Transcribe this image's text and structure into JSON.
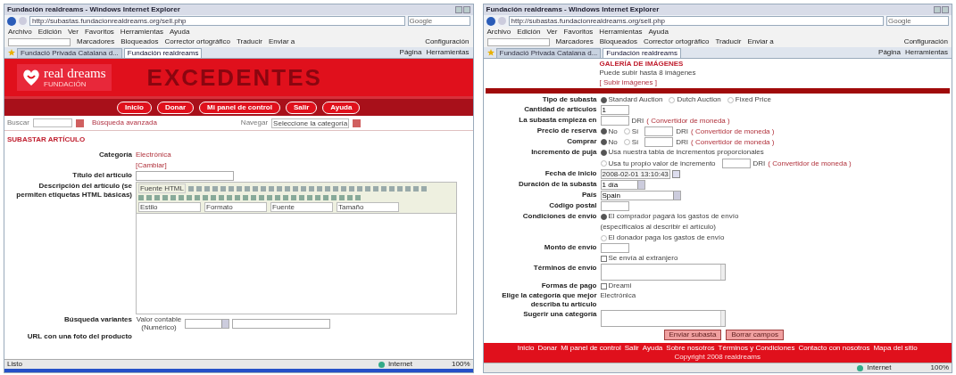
{
  "windows": [
    {
      "title": "Fundación realdreams - Windows Internet Explorer",
      "url": "http://subastas.fundacionrealdreams.org/sell.php",
      "search_placeholder": "Google",
      "menu": [
        "Archivo",
        "Edición",
        "Ver",
        "Favoritos",
        "Herramientas",
        "Ayuda"
      ],
      "google_toolbar": [
        "Marcadores",
        "Bloqueados",
        "Corrector ortográfico",
        "Traducir",
        "Enviar a"
      ],
      "google_settings": "Configuración",
      "tabs": [
        {
          "label": "Fundació Privada Catalana d...",
          "selected": false
        },
        {
          "label": "Fundación realdreams",
          "selected": true
        }
      ],
      "command_bar": [
        "Página",
        "Herramientas"
      ],
      "status": {
        "text": "Listo",
        "zone": "Internet",
        "zoom": "100%"
      },
      "taskbar": true,
      "page": {
        "kind": "sell_article",
        "header": {
          "logo_text": "real dreams",
          "logo_sub": "FUNDACIÓN",
          "banner": "EXCEDENTES"
        },
        "nav": [
          "Inicio",
          "Donar",
          "Mi panel de control",
          "Salir",
          "Ayuda"
        ],
        "search": {
          "label": "Buscar",
          "advanced": "Búsqueda avanzada",
          "browse_label": "Navegar",
          "browse_value": "Seleccione la categoría"
        },
        "heading": "SUBASTAR ARTÍCULO",
        "rows": [
          {
            "label": "Categoría",
            "fields": [
              {
                "kind": "link",
                "text": "Electrónica"
              },
              {
                "kind": "break"
              },
              {
                "kind": "link",
                "text": "[Cambiar]"
              }
            ]
          },
          {
            "label": "Título del artículo",
            "fields": [
              {
                "kind": "wide_input"
              }
            ]
          },
          {
            "label": "Descripción del artículo (se permiten etiquetas HTML básicas)",
            "fields": [
              {
                "kind": "editor",
                "source": "Fuente HTML",
                "dropdowns": [
                  "Estilo",
                  "Formato",
                  "Fuente",
                  "Tamaño"
                ]
              }
            ]
          },
          {
            "label": "Búsqueda variantes",
            "fields": [
              {
                "kind": "note",
                "text": "Valor contable (Numérico)"
              },
              {
                "kind": "select"
              },
              {
                "kind": "wide_input"
              }
            ]
          },
          {
            "label": "URL con una foto del producto",
            "fields": []
          }
        ]
      }
    },
    {
      "title": "Fundación realdreams - Windows Internet Explorer",
      "url": "http://subastas.fundacionrealdreams.org/sell.php",
      "search_placeholder": "Google",
      "menu": [
        "Archivo",
        "Edición",
        "Ver",
        "Favoritos",
        "Herramientas",
        "Ayuda"
      ],
      "google_toolbar": [
        "Marcadores",
        "Bloqueados",
        "Corrector ortográfico",
        "Traducir",
        "Enviar a"
      ],
      "google_settings": "Configuración",
      "tabs": [
        {
          "label": "Fundació Privada Catalana d...",
          "selected": false
        },
        {
          "label": "Fundación realdreams",
          "selected": true
        }
      ],
      "command_bar": [
        "Página",
        "Herramientas"
      ],
      "status": {
        "zone": "Internet",
        "zoom": "100%"
      },
      "page": {
        "kind": "sell_details",
        "gallery": {
          "title": "GALERÍA DE IMÁGENES",
          "text": "Puede subir hasta 8 imágenes",
          "link": "[ Subir imágenes ]"
        },
        "rows": [
          {
            "label": "Tipo de subasta",
            "fields": [
              {
                "kind": "radio",
                "label": "Standard Auction",
                "selected": true
              },
              {
                "kind": "radio",
                "label": "Dutch Auction",
                "selected": false
              },
              {
                "kind": "radio",
                "label": "Fixed Price",
                "selected": false
              }
            ]
          },
          {
            "label": "Cantidad de artículos",
            "fields": [
              {
                "kind": "input",
                "value": "1"
              }
            ]
          },
          {
            "label": "La subasta empieza en",
            "fields": [
              {
                "kind": "input"
              },
              {
                "kind": "text",
                "text": "DRI"
              },
              {
                "kind": "link",
                "text": "( Convertidor de moneda )"
              }
            ]
          },
          {
            "label": "Precio de reserva",
            "fields": [
              {
                "kind": "radio",
                "label": "No",
                "selected": true
              },
              {
                "kind": "radio",
                "label": "Sí",
                "selected": false
              },
              {
                "kind": "input"
              },
              {
                "kind": "text",
                "text": "DRI"
              },
              {
                "kind": "link",
                "text": "( Convertidor de moneda )"
              }
            ]
          },
          {
            "label": "Comprar",
            "fields": [
              {
                "kind": "radio",
                "label": "No",
                "selected": true
              },
              {
                "kind": "radio",
                "label": "Sí",
                "selected": false
              },
              {
                "kind": "input"
              },
              {
                "kind": "text",
                "text": "DRI"
              },
              {
                "kind": "link",
                "text": "( Convertidor de moneda )"
              }
            ]
          },
          {
            "label": "Incremento de puja",
            "fields": [
              {
                "kind": "radio",
                "label": "Usa nuestra tabla de incrementos proporcionales",
                "selected": true
              },
              {
                "kind": "break"
              },
              {
                "kind": "radio",
                "label": "Usa tu propio valor de incremento",
                "selected": false
              },
              {
                "kind": "input"
              },
              {
                "kind": "text",
                "text": "DRI"
              },
              {
                "kind": "link",
                "text": "( Convertidor de moneda )"
              }
            ]
          },
          {
            "label": "Fecha de inicio",
            "fields": [
              {
                "kind": "date",
                "value": "2008-02-01 13:10:43"
              }
            ]
          },
          {
            "label": "Duración de la subasta",
            "fields": [
              {
                "kind": "select",
                "value": "1 día"
              }
            ]
          },
          {
            "label": "País",
            "fields": [
              {
                "kind": "wide_select",
                "value": "Spain"
              }
            ]
          },
          {
            "label": "Código postal",
            "fields": [
              {
                "kind": "input"
              }
            ]
          },
          {
            "label": "Condiciones de envío",
            "fields": [
              {
                "kind": "radio",
                "label": "El comprador pagará los gastos de envío",
                "selected": true
              },
              {
                "kind": "break"
              },
              {
                "kind": "text",
                "text": "(especifícalos al describir el artículo)"
              },
              {
                "kind": "break"
              },
              {
                "kind": "radio",
                "label": "El donador paga los gastos de envío",
                "selected": false
              }
            ]
          },
          {
            "label": "Monto de envío",
            "fields": [
              {
                "kind": "input"
              }
            ]
          },
          {
            "label": "",
            "fields": [
              {
                "kind": "checkbox",
                "label": "Se envía al extranjero",
                "checked": false
              }
            ]
          },
          {
            "label": "Términos de envío",
            "fields": [
              {
                "kind": "textarea"
              }
            ]
          },
          {
            "label": "Formas de pago",
            "fields": [
              {
                "kind": "checkbox",
                "label": "Dreami",
                "checked": false
              }
            ]
          },
          {
            "label": "Elige la categoría que mejor describa tu artículo",
            "fields": [
              {
                "kind": "text",
                "text": "Electrónica"
              }
            ]
          },
          {
            "label": "Sugerir una categoría",
            "fields": [
              {
                "kind": "textarea"
              }
            ]
          }
        ],
        "buttons": [
          "Enviar subasta",
          "Borrar campos"
        ],
        "footer": {
          "links": [
            "Inicio",
            "Donar",
            "Mi panel de control",
            "Salir",
            "Ayuda",
            "Sobre nosotros",
            "Términos y Condiciones",
            "Contacto con nosotros",
            "Mapa del sitio"
          ],
          "copyright": "Copyright 2008 realdreams"
        }
      }
    }
  ]
}
